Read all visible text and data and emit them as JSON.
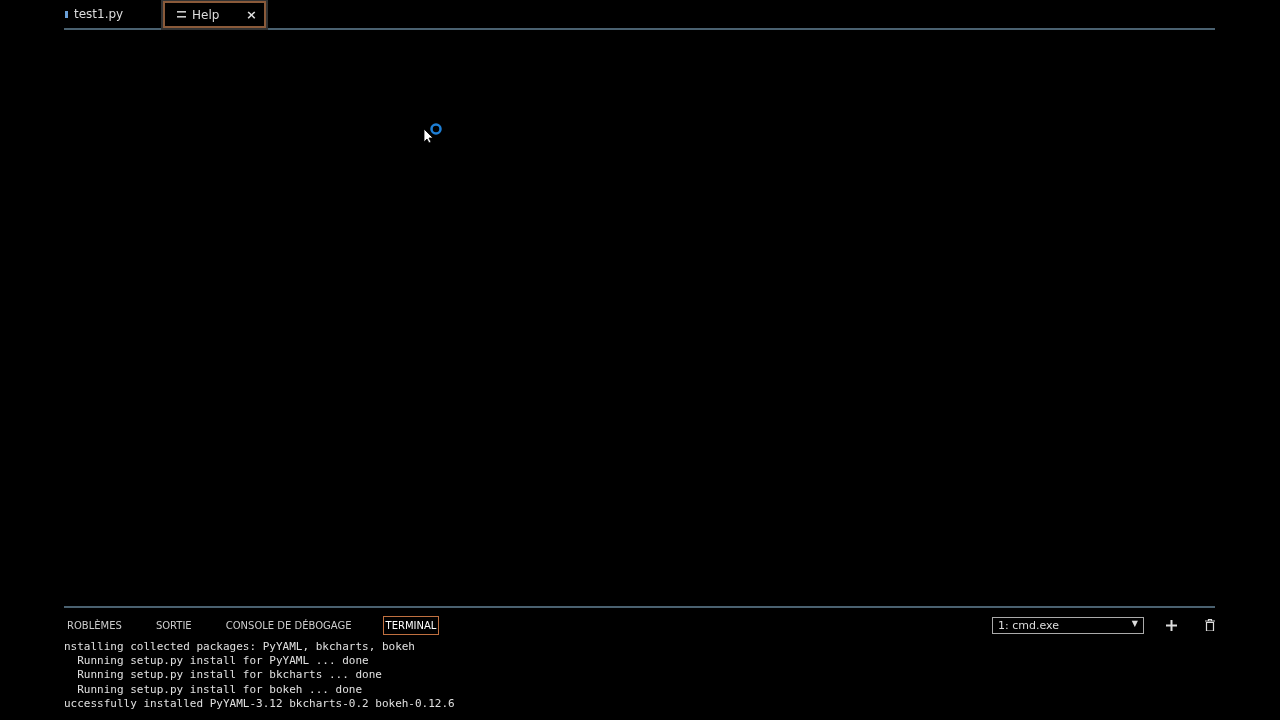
{
  "editor_tabs": [
    {
      "label": "test1.py",
      "selected": false
    },
    {
      "label": "Help",
      "selected": true,
      "close": "×"
    }
  ],
  "panel_tabs": [
    {
      "label": "ROBLÈMES",
      "selected": false
    },
    {
      "label": "SORTIE",
      "selected": false
    },
    {
      "label": "CONSOLE DE DÉBOGAGE",
      "selected": false
    },
    {
      "label": "TERMINAL",
      "selected": true
    }
  ],
  "terminal_select": {
    "value": "1: cmd.exe",
    "caret": "▼"
  },
  "terminal_lines": [
    "nstalling collected packages: PyYAML, bkcharts, bokeh",
    "  Running setup.py install for PyYAML ... done",
    "  Running setup.py install for bkcharts ... done",
    "  Running setup.py install for bokeh ... done",
    "uccessfully installed PyYAML-3.12 bkcharts-0.2 bokeh-0.12.6"
  ]
}
